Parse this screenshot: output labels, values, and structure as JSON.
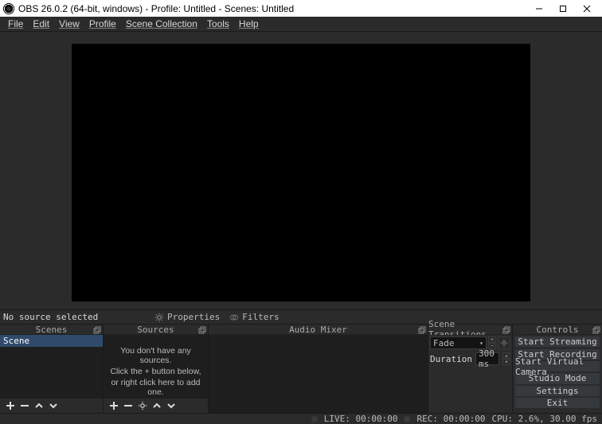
{
  "title": "OBS 26.0.2 (64-bit, windows) - Profile: Untitled - Scenes: Untitled",
  "menu": [
    "File",
    "Edit",
    "View",
    "Profile",
    "Scene Collection",
    "Tools",
    "Help"
  ],
  "source_bar": {
    "no_source": "No source selected",
    "properties": "Properties",
    "filters": "Filters"
  },
  "panels": {
    "scenes": {
      "title": "Scenes",
      "items": [
        "Scene"
      ]
    },
    "sources": {
      "title": "Sources",
      "empty": {
        "l1": "You don't have any sources.",
        "l2": "Click the + button below,",
        "l3": "or right click here to add one."
      }
    },
    "mixer": {
      "title": "Audio Mixer"
    },
    "transitions": {
      "title": "Scene Transitions",
      "selected": "Fade",
      "duration_label": "Duration",
      "duration_value": "300 ms"
    },
    "controls": {
      "title": "Controls",
      "buttons": [
        "Start Streaming",
        "Start Recording",
        "Start Virtual Camera",
        "Studio Mode",
        "Settings",
        "Exit"
      ]
    }
  },
  "status": {
    "live": "LIVE: 00:00:00",
    "rec": "REC: 00:00:00",
    "cpu": "CPU: 2.6%, 30.00 fps"
  }
}
